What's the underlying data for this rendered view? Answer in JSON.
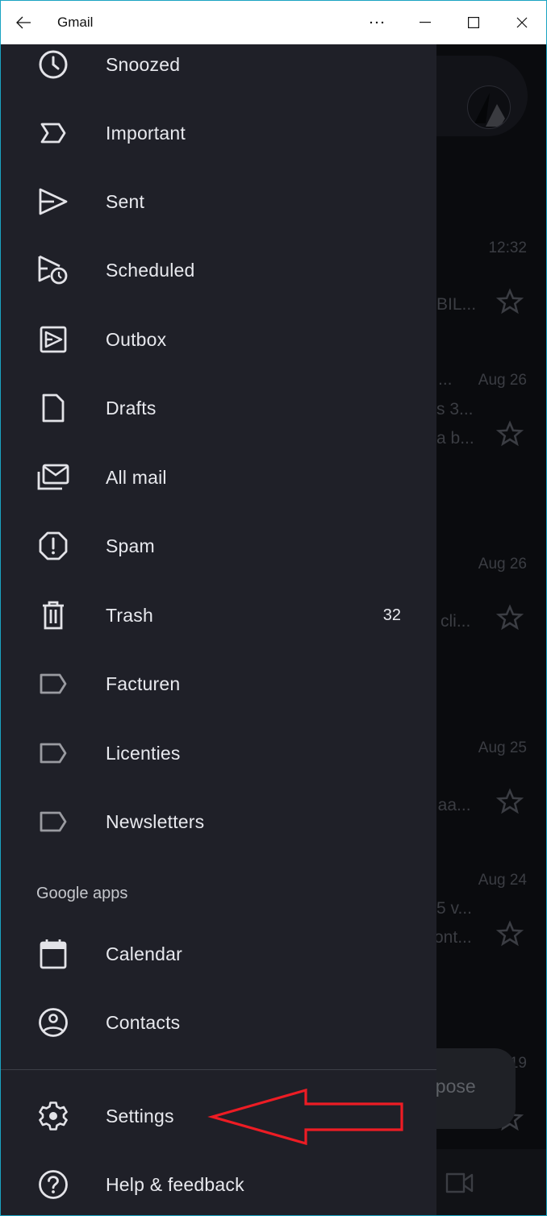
{
  "window": {
    "title": "Gmail",
    "controls": [
      "back",
      "more",
      "minimize",
      "maximize",
      "close"
    ]
  },
  "drawer": {
    "items": [
      {
        "label": "Snoozed",
        "icon": "clock-icon"
      },
      {
        "label": "Important",
        "icon": "important-icon"
      },
      {
        "label": "Sent",
        "icon": "send-icon"
      },
      {
        "label": "Scheduled",
        "icon": "scheduled-send-icon"
      },
      {
        "label": "Outbox",
        "icon": "outbox-icon"
      },
      {
        "label": "Drafts",
        "icon": "draft-icon"
      },
      {
        "label": "All mail",
        "icon": "all-mail-icon"
      },
      {
        "label": "Spam",
        "icon": "spam-icon"
      },
      {
        "label": "Trash",
        "icon": "trash-icon",
        "count": "32"
      },
      {
        "label": "Facturen",
        "icon": "label-icon"
      },
      {
        "label": "Licenties",
        "icon": "label-icon"
      },
      {
        "label": "Newsletters",
        "icon": "label-icon"
      }
    ],
    "google_apps_heading": "Google apps",
    "apps": [
      {
        "label": "Calendar",
        "icon": "calendar-icon"
      },
      {
        "label": "Contacts",
        "icon": "contacts-icon"
      }
    ],
    "footer": [
      {
        "label": "Settings",
        "icon": "gear-icon"
      },
      {
        "label": "Help & feedback",
        "icon": "help-icon"
      }
    ]
  },
  "mail_list_background": {
    "rows": [
      {
        "time": "12:32",
        "snippets": [
          "BIL..."
        ]
      },
      {
        "time": "Aug 26",
        "snippets": [
          "...",
          "s 3...",
          "a b..."
        ]
      },
      {
        "time": "Aug 26",
        "snippets": [
          "cli..."
        ]
      },
      {
        "time": "Aug 25",
        "snippets": [
          "t aa..."
        ]
      },
      {
        "time": "Aug 24",
        "snippets": [
          "5 v...",
          "ont..."
        ]
      },
      {
        "time": "19",
        "snippets": []
      }
    ],
    "compose_label": "npose"
  },
  "annotation": {
    "type": "arrow",
    "points_to": "Settings",
    "color": "#ed1c24"
  }
}
